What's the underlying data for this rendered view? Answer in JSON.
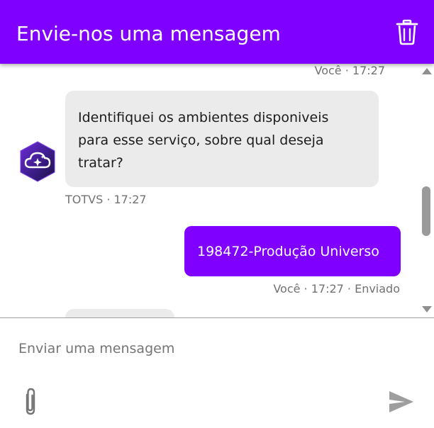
{
  "header": {
    "title": "Envie-nos uma mensagem",
    "delete_icon": "trash-icon"
  },
  "messages": [
    {
      "sender": "Você",
      "time": "17:27",
      "meta": "Você · 17:27"
    },
    {
      "sender": "TOTVS",
      "time": "17:27",
      "text": "Identifiquei os ambientes disponiveis para esse serviço, sobre qual deseja tratar?",
      "meta": "TOTVS · 17:27",
      "avatar_icon": "cloud-sparkle-icon"
    },
    {
      "sender": "Você",
      "time": "17:27",
      "status": "Enviado",
      "text": "198472-Produção Universo",
      "meta": "Você · 17:27 · Enviado"
    }
  ],
  "composer": {
    "placeholder": "Enviar uma mensagem",
    "value": "",
    "attach_icon": "paperclip-icon",
    "send_icon": "send-icon"
  },
  "colors": {
    "brand": "#8000ff",
    "bot_bubble": "#ebebeb",
    "meta_text": "#727272"
  }
}
